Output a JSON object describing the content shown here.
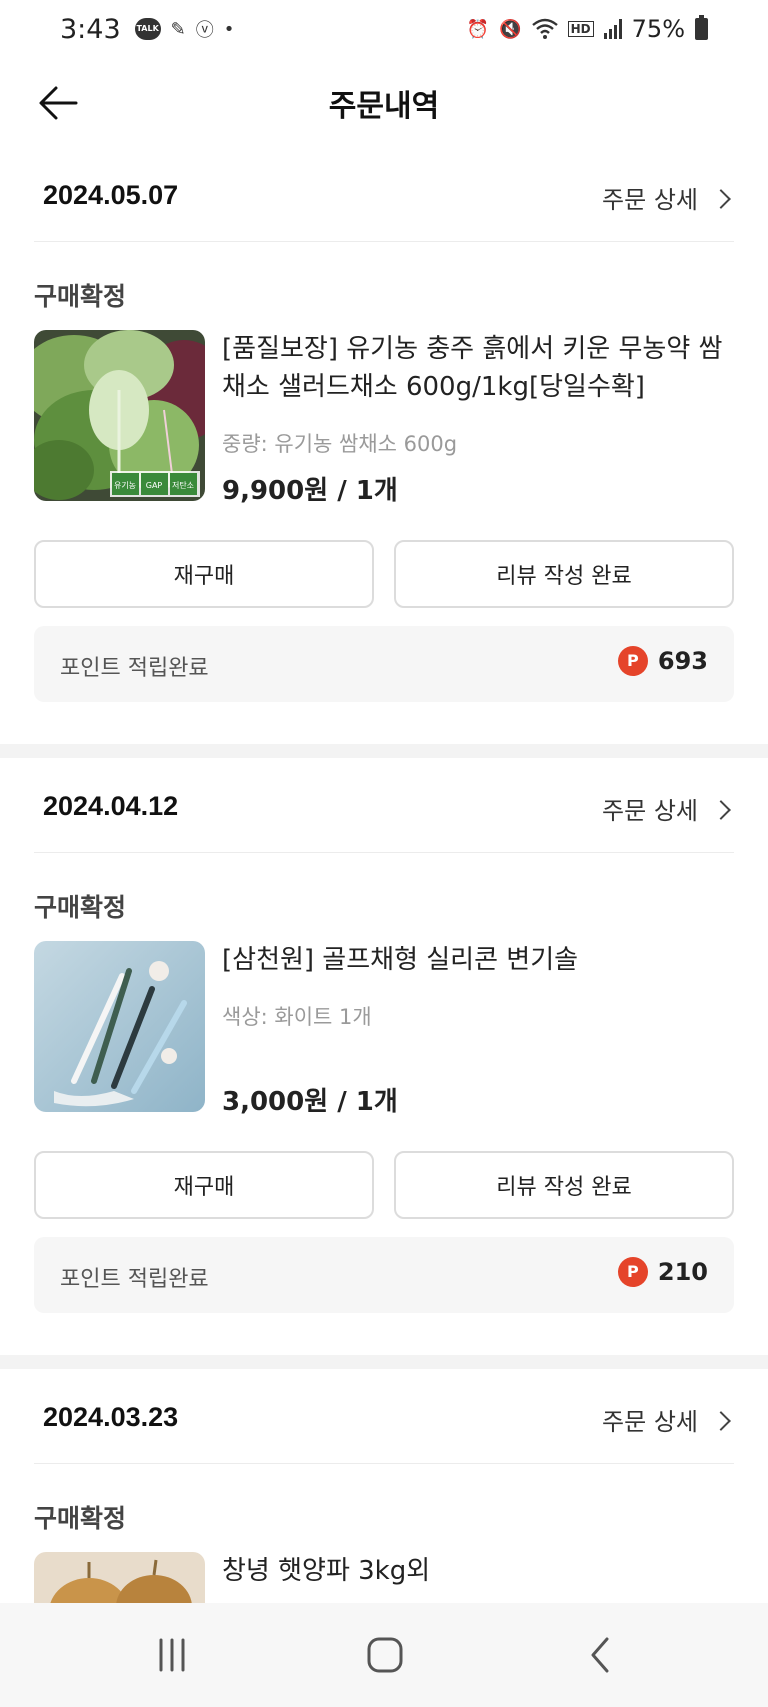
{
  "status_bar": {
    "time": "3:43",
    "battery": "75%",
    "talk_badge": "TALK",
    "hd_badge": "HD"
  },
  "header": {
    "title": "주문내역"
  },
  "orders": [
    {
      "date": "2024.05.07",
      "detail_label": "주문 상세",
      "status": "구매확정",
      "product_name": "[품질보장] 유기농 충주 흙에서 키운 무농약 쌈채소 샐러드채소 600g/1kg[당일수확]",
      "option": "중량: 유기농 쌈채소 600g",
      "price": "9,900원 / 1개",
      "thumb_labels": [
        "유기농",
        "GAP",
        "저탄소"
      ],
      "rebuy_label": "재구매",
      "review_label": "리뷰 작성 완료",
      "points_label": "포인트 적립완료",
      "points_icon": "P",
      "points_value": "693"
    },
    {
      "date": "2024.04.12",
      "detail_label": "주문 상세",
      "status": "구매확정",
      "product_name": "[삼천원] 골프채형 실리콘 변기솔",
      "option": "색상: 화이트 1개",
      "price": "3,000원 / 1개",
      "rebuy_label": "재구매",
      "review_label": "리뷰 작성 완료",
      "points_label": "포인트 적립완료",
      "points_icon": "P",
      "points_value": "210"
    },
    {
      "date": "2024.03.23",
      "detail_label": "주문 상세",
      "status": "구매확정",
      "product_name": "창녕 햇양파 3kg외"
    }
  ],
  "colors": {
    "points_icon": "#e5442a",
    "points_bg": "#f6f6f6",
    "divider": "#f3f3f3"
  }
}
